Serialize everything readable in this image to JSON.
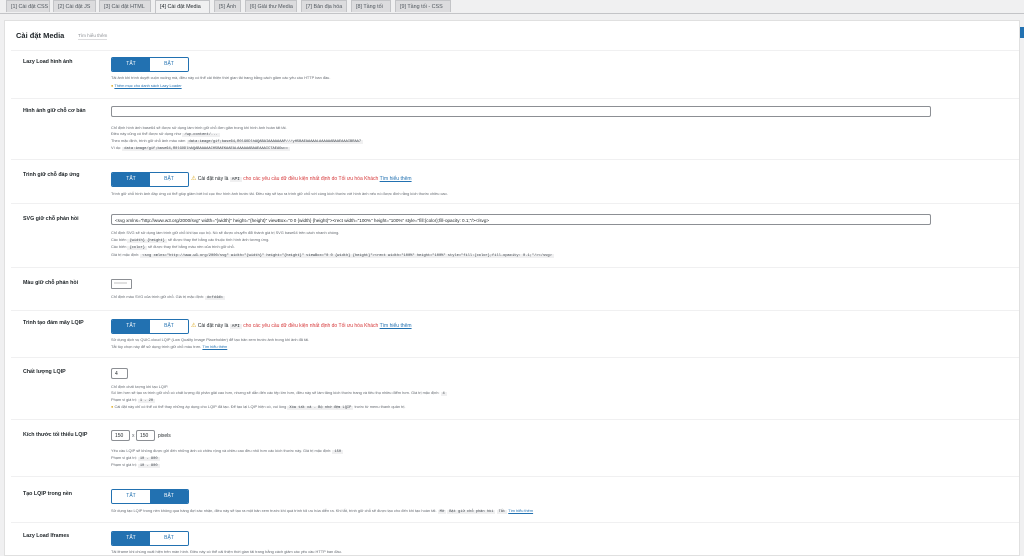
{
  "tabs": [
    {
      "label": "[1] Cài đặt CSS",
      "active": false
    },
    {
      "label": "[2] Cài đặt JS",
      "active": false
    },
    {
      "label": "[3] Cài đặt HTML",
      "active": false
    },
    {
      "label": "[4] Cài đặt Media",
      "active": true
    },
    {
      "label": "[5] Ảnh",
      "active": false
    },
    {
      "label": "[6] Giải thư Media",
      "active": false
    },
    {
      "label": "[7] Bản địa hóa",
      "active": false
    },
    {
      "label": "[8] Tầng tối",
      "active": false
    },
    {
      "label": "[9] Tầng tối - CSS",
      "active": false
    }
  ],
  "page": {
    "title": "Cài đặt Media",
    "link": "Tìm hiểu thêm"
  },
  "toggle": {
    "off": "TẮT",
    "on": "BẬT"
  },
  "warning": {
    "prefix": "Cài đặt này là",
    "code": "API",
    "middle": "cho các yêu cầu dữ điều kiện nhất định do",
    "highlight": "Tối ưu hóa Khách",
    "link": "Tìm hiểu thêm"
  },
  "lazy_load": {
    "label": "Lazy Load hình ảnh",
    "desc": "Tải ảnh khi trình duyệt cuộn xuống mà, điều này có thể cải thiện thời gian tải trang bằng cách giảm các yêu cầu HTTP ban đầu.",
    "link": "Thêm mục cho danh sách Lazy Loader"
  },
  "placeholder": {
    "label": "Hình ảnh giữ chỗ cơ bản",
    "input_value": "",
    "desc": [
      "Chỉ định hình ảnh base64 sẽ được sử dụng làm trình giữ chỗ đơn giản trong khi hình ảnh hoàn tất tải.",
      "Điều này cũng có thể được sử dụng như",
      "Theo mặc định, trình giữ chỗ ảnh màu xám",
      "Ví dụ:"
    ],
    "code1": "/wp-content/...",
    "code2": "data:image/gif;base64,R0lGODlhAQABAIAAAAAAAP///yH5BAEAAAAALAAAAAABAAEAAAIBRAA7",
    "code3": "data:image/gif;base64,R0lGODlhAQABAAAAACH5BAEKAAEALAAAAAABAAEAAAICTAEAOw=="
  },
  "responsive": {
    "label": "Trình giữ chỗ đáp ứng",
    "desc": "Trình giữ chỗ hình ảnh đáp ứng có thể giúp giảm bớt bố cục thư hình ảnh bước tải. Điều này sẽ tạo ra trình giữ chỗ với cùng kích thước với hình ảnh nếu nó được đính rằng kích thước chiều cao."
  },
  "svg": {
    "label": "SVG giữ chỗ phản hồi",
    "input_value": "<svg xmlns=\"http://www.w3.org/2000/svg\" width=\"{width}\" height=\"{height}\" viewBox=\"0 0 {width} {height}\"><rect width=\"100%\" height=\"100%\" style=\"fill:{color};fill-opacity: 0.1;\"/></svg>",
    "desc": [
      "Chỉ định SVG sẽ sử dụng làm trình giữ chỗ khi tạo cục bộ. Nó sẽ được chuyển đổi thành giá trị SVG base64 trên cách nhanh chóng.",
      "Các biến",
      "sẽ được thay thế bằng các thuộc tính hình ảnh tương ứng.",
      "Các biến",
      "sẽ được thay thế bằng màu nền của trình giữ chỗ.",
      "Giá trị mặc định:"
    ],
    "code_wh": "{width} {height}",
    "code_color": "{color}",
    "code_default": "<svg xmlns=\"http://www.w3.org/2000/svg\" width=\"{width}\" height=\"{height}\" viewBox=\"0 0 {width} {height}\"><rect width=\"100%\" height=\"100%\" style=\"fill:{color};fill-opacity: 0.1;\"/></svg>"
  },
  "color": {
    "label": "Màu giữ chỗ phản hồi",
    "desc": "Chỉ định màu SVG của trình giữ chỗ. Giá trị mặc định:",
    "code": "#cfd4db"
  },
  "lqip": {
    "label": "Trình tạo đám mây LQIP",
    "desc1": "Sử dụng dịch vụ QUIC.cloud LQIP (Low Quality Image Placeholder) để tạo bản xem trước ảnh trong khi ảnh đã tải.",
    "desc2": "Tắt tùy chọn này để sử dụng trình giữ chỗ màu trơn.",
    "link": "Tìm hiểu thêm"
  },
  "lqip_quality": {
    "label": "Chất lượng LQIP",
    "value": "4",
    "desc1": "Chỉ định chất lượng khi tạo LQIP.",
    "desc2": "Số lớn hơn sẽ tạo ra trình giữ chỗ có chất lượng độ phân giải cao hơn, nhưng sẽ dẫn đến các tệp lớn hơn, điều này sẽ làm tăng kích thước trang và tiêu thụ nhiều điểm hơn. Giá trị mặc định:",
    "default": "4",
    "range": "Phạm vi giá trị:",
    "range_code": "1 - 20",
    "note": "Cài đặt này chỉ có thể có thể thay những áp dụng cho LQIP đã tạo. Để tạo lại LQIP hiện có, vui lòng",
    "code_ext": "Xóa tất cả - Bộ nhớ đệm LQIP",
    "note_end": "trước từ menu thanh quản trị."
  },
  "lqip_min": {
    "label": "Kích thước tối thiểu LQIP",
    "w": "150",
    "h": "150",
    "x": "x",
    "unit": "pixels",
    "desc1": "Yêu cầu LQIP sẽ không được gửi đến những ảnh có chiều rộng và chiều cao đều nhỏ hơn các kích thước này. Giá trị mặc định:",
    "default": "150",
    "range1": "Phạm vi giá trị:",
    "code1": "10 - 800",
    "range2": "Phạm vi giá trị:",
    "code2": "10 - 800"
  },
  "lqip_bg": {
    "label": "Tạo LQIP trong nền",
    "desc": "Sử dụng tạo LQIP trong nền không qua hàng đợi xác nhận, điều này sẽ tạo ra một bản xem trước khi quá trình tối ưu hóa diễn ra. Khi tắt, trình giữ chỗ sẽ được tạo cho đến khi tạo hoàn tất.",
    "code1": "Mở",
    "code2": "Bật giữ chỗ phản hồi",
    "code3": "Tắt",
    "link": "Tìm hiểu thêm"
  },
  "lazy_iframes": {
    "label": "Lazy Load Iframes",
    "desc": "Tải iframe khi chúng xuất hiện trên màn hình. Điều này có thể cải thiện thời gian tải trang bằng cách giảm các yêu cầu HTTP ban đầu."
  }
}
